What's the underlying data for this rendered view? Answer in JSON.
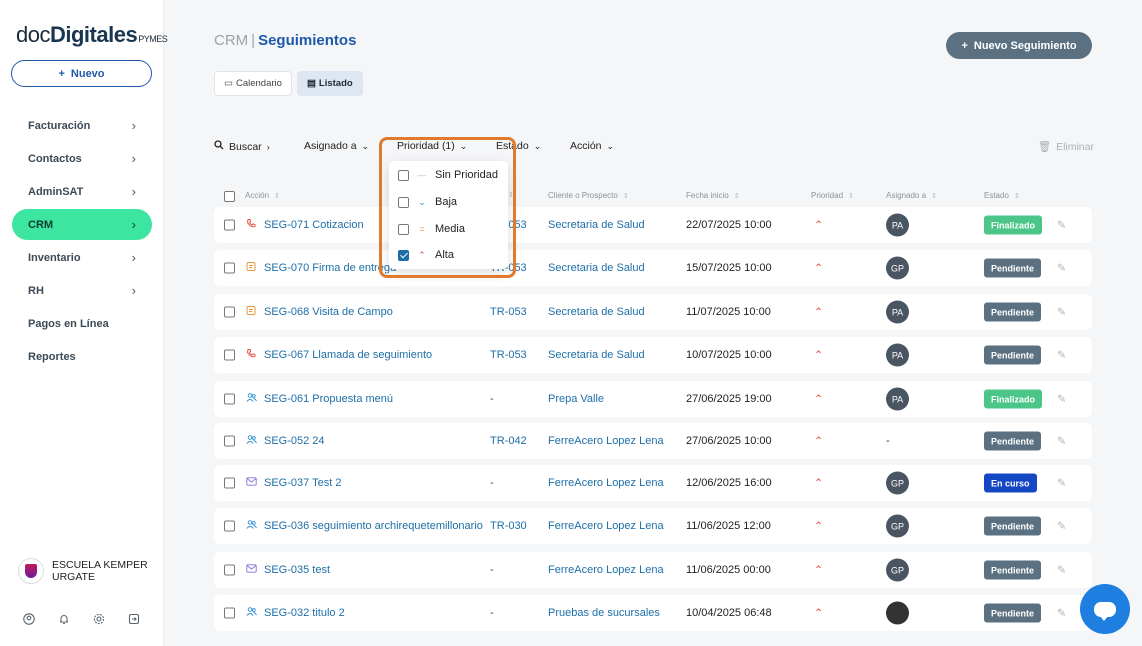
{
  "brand": {
    "part1": "doc",
    "part2": "Digitales",
    "part3": "PYMES"
  },
  "sidebar": {
    "nuevo_label": "Nuevo",
    "items": [
      {
        "label": "Facturación",
        "chevron": true
      },
      {
        "label": "Contactos",
        "chevron": true
      },
      {
        "label": "AdminSAT",
        "chevron": true
      },
      {
        "label": "CRM",
        "chevron": true,
        "active": true
      },
      {
        "label": "Inventario",
        "chevron": true
      },
      {
        "label": "RH",
        "chevron": true
      },
      {
        "label": "Pagos en Línea",
        "chevron": false
      },
      {
        "label": "Reportes",
        "chevron": false
      }
    ],
    "company": "ESCUELA KEMPER URGATE"
  },
  "header": {
    "crumb": "CRM",
    "title": "Seguimientos",
    "new_label": "Nuevo Seguimiento"
  },
  "views": {
    "calendar": "Calendario",
    "list": "Listado"
  },
  "filters": {
    "search": "Buscar",
    "assigned": "Asignado a",
    "priority": "Prioridad (1)",
    "status": "Estado",
    "action": "Acción",
    "delete": "Eliminar"
  },
  "columns": {
    "accion": "Acción",
    "cliente": "Cliente o Prospecto",
    "fecha": "Fecha inicio",
    "prioridad": "Prioridad",
    "asignado": "Asignado a",
    "estado": "Estado"
  },
  "priority_menu": [
    {
      "label": "Sin Prioridad",
      "mark": "—",
      "checked": false
    },
    {
      "label": "Baja",
      "mark": "⌄",
      "checked": false
    },
    {
      "label": "Media",
      "mark": "=",
      "checked": false
    },
    {
      "label": "Alta",
      "mark": "⌃",
      "checked": true
    }
  ],
  "rows": [
    {
      "type": "phone-icon",
      "accion": "SEG-071 Cotizacion",
      "ref": "TR-053",
      "cliente": "Secretaria de Salud",
      "fecha": "22/07/2025 10:00",
      "prio": "⌃",
      "avatar": "PA",
      "estado": "Finalizado",
      "estado_kind": "fin"
    },
    {
      "type": "note-icon",
      "accion": "SEG-070 Firma de entrega",
      "ref": "TR-053",
      "cliente": "Secretaria de Salud",
      "fecha": "15/07/2025 10:00",
      "prio": "⌃",
      "avatar": "GP",
      "estado": "Pendiente",
      "estado_kind": "pen"
    },
    {
      "type": "note-icon",
      "accion": "SEG-068 Visita de Campo",
      "ref": "TR-053",
      "cliente": "Secretaria de Salud",
      "fecha": "11/07/2025 10:00",
      "prio": "⌃",
      "avatar": "PA",
      "estado": "Pendiente",
      "estado_kind": "pen"
    },
    {
      "type": "phone-icon",
      "accion": "SEG-067 Llamada de seguimiento",
      "ref": "TR-053",
      "cliente": "Secretaria de Salud",
      "fecha": "10/07/2025 10:00",
      "prio": "⌃",
      "avatar": "PA",
      "estado": "Pendiente",
      "estado_kind": "pen"
    },
    {
      "type": "people-icon",
      "accion": "SEG-061 Propuesta menú",
      "ref": "-",
      "cliente": "Prepa Valle",
      "fecha": "27/06/2025 19:00",
      "prio": "⌃",
      "avatar": "PA",
      "estado": "Finalizado",
      "estado_kind": "fin"
    },
    {
      "type": "people-icon",
      "accion": "SEG-052 24",
      "ref": "TR-042",
      "cliente": "FerreAcero Lopez Lena",
      "fecha": "27/06/2025 10:00",
      "prio": "⌃",
      "avatar": "-",
      "estado": "Pendiente",
      "estado_kind": "pen"
    },
    {
      "type": "mail-icon",
      "accion": "SEG-037 Test 2",
      "ref": "-",
      "cliente": "FerreAcero Lopez Lena",
      "fecha": "12/06/2025 16:00",
      "prio": "⌃",
      "avatar": "GP",
      "estado": "En curso",
      "estado_kind": "cur"
    },
    {
      "type": "people-icon",
      "accion": "SEG-036 seguimiento archirequetemillonario",
      "ref": "TR-030",
      "cliente": "FerreAcero Lopez Lena",
      "fecha": "11/06/2025 12:00",
      "prio": "⌃",
      "avatar": "GP",
      "estado": "Pendiente",
      "estado_kind": "pen"
    },
    {
      "type": "mail-icon",
      "accion": "SEG-035 test",
      "ref": "-",
      "cliente": "FerreAcero Lopez Lena",
      "fecha": "11/06/2025 00:00",
      "prio": "⌃",
      "avatar": "GP",
      "estado": "Pendiente",
      "estado_kind": "pen"
    },
    {
      "type": "people-icon",
      "accion": "SEG-032 titulo 2",
      "ref": "-",
      "cliente": "Pruebas de sucursales",
      "fecha": "10/04/2025 06:48",
      "prio": "⌃",
      "avatar": "",
      "estado": "Pendiente",
      "estado_kind": "pen"
    }
  ]
}
